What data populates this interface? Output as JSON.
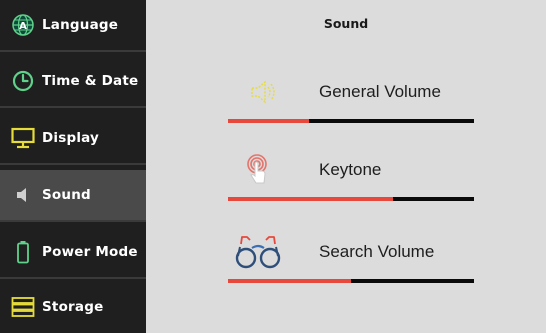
{
  "sidebar": {
    "items": [
      {
        "label": "Language",
        "icon": "globe-icon"
      },
      {
        "label": "Time & Date",
        "icon": "clock-icon"
      },
      {
        "label": "Display",
        "icon": "monitor-icon"
      },
      {
        "label": "Sound",
        "icon": "speaker-icon",
        "active": true
      },
      {
        "label": "Power Mode",
        "icon": "battery-icon"
      },
      {
        "label": "Storage",
        "icon": "storage-icon"
      }
    ]
  },
  "main": {
    "title": "Sound",
    "settings": [
      {
        "label": "General Volume",
        "icon": "volume-icon",
        "level": 0.33
      },
      {
        "label": "Keytone",
        "icon": "touch-icon",
        "level": 0.67
      },
      {
        "label": "Search Volume",
        "icon": "binoculars-icon",
        "level": 0.5
      }
    ]
  },
  "colors": {
    "sidebar_bg": "#1f1f1f",
    "active_item_bg": "#4a4a4a",
    "slider_fill": "#e8473b",
    "slider_track": "#0a0a0a",
    "accent_green": "#5fd18a",
    "accent_yellow": "#e6dd3a"
  }
}
